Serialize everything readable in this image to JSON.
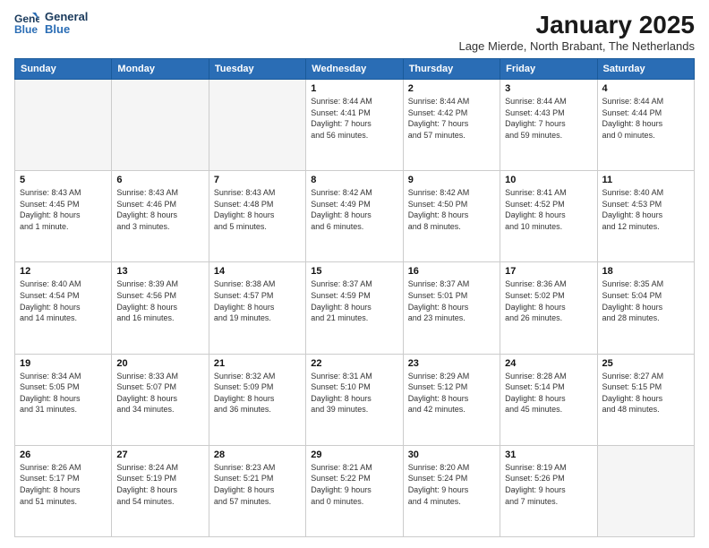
{
  "logo": {
    "line1": "General",
    "line2": "Blue"
  },
  "title": "January 2025",
  "subtitle": "Lage Mierde, North Brabant, The Netherlands",
  "headers": [
    "Sunday",
    "Monday",
    "Tuesday",
    "Wednesday",
    "Thursday",
    "Friday",
    "Saturday"
  ],
  "weeks": [
    [
      {
        "day": "",
        "info": ""
      },
      {
        "day": "",
        "info": ""
      },
      {
        "day": "",
        "info": ""
      },
      {
        "day": "1",
        "info": "Sunrise: 8:44 AM\nSunset: 4:41 PM\nDaylight: 7 hours\nand 56 minutes."
      },
      {
        "day": "2",
        "info": "Sunrise: 8:44 AM\nSunset: 4:42 PM\nDaylight: 7 hours\nand 57 minutes."
      },
      {
        "day": "3",
        "info": "Sunrise: 8:44 AM\nSunset: 4:43 PM\nDaylight: 7 hours\nand 59 minutes."
      },
      {
        "day": "4",
        "info": "Sunrise: 8:44 AM\nSunset: 4:44 PM\nDaylight: 8 hours\nand 0 minutes."
      }
    ],
    [
      {
        "day": "5",
        "info": "Sunrise: 8:43 AM\nSunset: 4:45 PM\nDaylight: 8 hours\nand 1 minute."
      },
      {
        "day": "6",
        "info": "Sunrise: 8:43 AM\nSunset: 4:46 PM\nDaylight: 8 hours\nand 3 minutes."
      },
      {
        "day": "7",
        "info": "Sunrise: 8:43 AM\nSunset: 4:48 PM\nDaylight: 8 hours\nand 5 minutes."
      },
      {
        "day": "8",
        "info": "Sunrise: 8:42 AM\nSunset: 4:49 PM\nDaylight: 8 hours\nand 6 minutes."
      },
      {
        "day": "9",
        "info": "Sunrise: 8:42 AM\nSunset: 4:50 PM\nDaylight: 8 hours\nand 8 minutes."
      },
      {
        "day": "10",
        "info": "Sunrise: 8:41 AM\nSunset: 4:52 PM\nDaylight: 8 hours\nand 10 minutes."
      },
      {
        "day": "11",
        "info": "Sunrise: 8:40 AM\nSunset: 4:53 PM\nDaylight: 8 hours\nand 12 minutes."
      }
    ],
    [
      {
        "day": "12",
        "info": "Sunrise: 8:40 AM\nSunset: 4:54 PM\nDaylight: 8 hours\nand 14 minutes."
      },
      {
        "day": "13",
        "info": "Sunrise: 8:39 AM\nSunset: 4:56 PM\nDaylight: 8 hours\nand 16 minutes."
      },
      {
        "day": "14",
        "info": "Sunrise: 8:38 AM\nSunset: 4:57 PM\nDaylight: 8 hours\nand 19 minutes."
      },
      {
        "day": "15",
        "info": "Sunrise: 8:37 AM\nSunset: 4:59 PM\nDaylight: 8 hours\nand 21 minutes."
      },
      {
        "day": "16",
        "info": "Sunrise: 8:37 AM\nSunset: 5:01 PM\nDaylight: 8 hours\nand 23 minutes."
      },
      {
        "day": "17",
        "info": "Sunrise: 8:36 AM\nSunset: 5:02 PM\nDaylight: 8 hours\nand 26 minutes."
      },
      {
        "day": "18",
        "info": "Sunrise: 8:35 AM\nSunset: 5:04 PM\nDaylight: 8 hours\nand 28 minutes."
      }
    ],
    [
      {
        "day": "19",
        "info": "Sunrise: 8:34 AM\nSunset: 5:05 PM\nDaylight: 8 hours\nand 31 minutes."
      },
      {
        "day": "20",
        "info": "Sunrise: 8:33 AM\nSunset: 5:07 PM\nDaylight: 8 hours\nand 34 minutes."
      },
      {
        "day": "21",
        "info": "Sunrise: 8:32 AM\nSunset: 5:09 PM\nDaylight: 8 hours\nand 36 minutes."
      },
      {
        "day": "22",
        "info": "Sunrise: 8:31 AM\nSunset: 5:10 PM\nDaylight: 8 hours\nand 39 minutes."
      },
      {
        "day": "23",
        "info": "Sunrise: 8:29 AM\nSunset: 5:12 PM\nDaylight: 8 hours\nand 42 minutes."
      },
      {
        "day": "24",
        "info": "Sunrise: 8:28 AM\nSunset: 5:14 PM\nDaylight: 8 hours\nand 45 minutes."
      },
      {
        "day": "25",
        "info": "Sunrise: 8:27 AM\nSunset: 5:15 PM\nDaylight: 8 hours\nand 48 minutes."
      }
    ],
    [
      {
        "day": "26",
        "info": "Sunrise: 8:26 AM\nSunset: 5:17 PM\nDaylight: 8 hours\nand 51 minutes."
      },
      {
        "day": "27",
        "info": "Sunrise: 8:24 AM\nSunset: 5:19 PM\nDaylight: 8 hours\nand 54 minutes."
      },
      {
        "day": "28",
        "info": "Sunrise: 8:23 AM\nSunset: 5:21 PM\nDaylight: 8 hours\nand 57 minutes."
      },
      {
        "day": "29",
        "info": "Sunrise: 8:21 AM\nSunset: 5:22 PM\nDaylight: 9 hours\nand 0 minutes."
      },
      {
        "day": "30",
        "info": "Sunrise: 8:20 AM\nSunset: 5:24 PM\nDaylight: 9 hours\nand 4 minutes."
      },
      {
        "day": "31",
        "info": "Sunrise: 8:19 AM\nSunset: 5:26 PM\nDaylight: 9 hours\nand 7 minutes."
      },
      {
        "day": "",
        "info": ""
      }
    ]
  ]
}
